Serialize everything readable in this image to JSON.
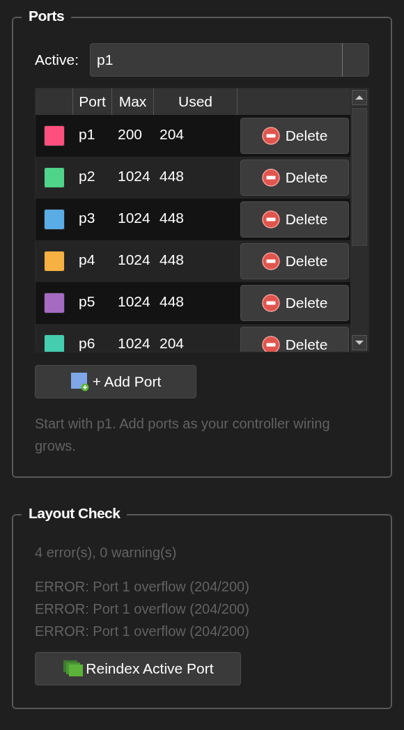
{
  "ports_group": {
    "title": "Ports",
    "active": {
      "label": "Active:",
      "value": "p1"
    },
    "table": {
      "columns": [
        "Port",
        "Max",
        "Used"
      ],
      "rows": [
        {
          "color": "#ff4f7f",
          "port": "p1",
          "max": "200",
          "used": "204",
          "action": "Delete"
        },
        {
          "color": "#4fd48a",
          "port": "p2",
          "max": "1024",
          "used": "448",
          "action": "Delete"
        },
        {
          "color": "#5aace6",
          "port": "p3",
          "max": "1024",
          "used": "448",
          "action": "Delete"
        },
        {
          "color": "#f7b142",
          "port": "p4",
          "max": "1024",
          "used": "448",
          "action": "Delete"
        },
        {
          "color": "#a56bc3",
          "port": "p5",
          "max": "1024",
          "used": "448",
          "action": "Delete"
        },
        {
          "color": "#45cdb0",
          "port": "p6",
          "max": "1024",
          "used": "204",
          "action": "Delete"
        }
      ]
    },
    "add_button": "+ Add Port",
    "hint": "Start with p1. Add ports as your controller wiring grows."
  },
  "layout_check": {
    "title": "Layout Check",
    "summary": "4 error(s), 0 warning(s)",
    "messages": [
      "ERROR: Port 1 overflow (204/200)",
      "ERROR: Port 1 overflow (204/200)",
      "ERROR: Port 1 overflow (204/200)"
    ],
    "reindex_button": "Reindex Active Port"
  }
}
